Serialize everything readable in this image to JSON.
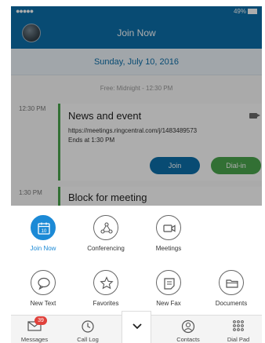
{
  "status_bar": {
    "signal": "●●●●●",
    "battery": "49%"
  },
  "header": {
    "title": "Join Now"
  },
  "calendar": {
    "date": "Sunday, July 10, 2016",
    "free_slot": "Free: Midnight - 12:30 PM",
    "events": [
      {
        "time": "12:30 PM",
        "title": "News and event",
        "link": "https://meetings.ringcentral.com/j/1483489573",
        "ends": "Ends at 1:30 PM",
        "join_label": "Join",
        "dial_label": "Dial-in"
      },
      {
        "time": "1:30 PM",
        "title": "Block for meeting"
      }
    ]
  },
  "actions": {
    "join_now": {
      "label": "Join Now",
      "icon": "calendar-icon",
      "date_num": "10"
    },
    "conferencing": {
      "label": "Conferencing",
      "icon": "conferencing-icon"
    },
    "meetings": {
      "label": "Meetings",
      "icon": "video-camera-icon"
    },
    "new_text": {
      "label": "New Text",
      "icon": "chat-bubble-icon"
    },
    "favorites": {
      "label": "Favorites",
      "icon": "star-icon"
    },
    "new_fax": {
      "label": "New Fax",
      "icon": "fax-icon"
    },
    "documents": {
      "label": "Documents",
      "icon": "folder-icon"
    }
  },
  "tabs": {
    "messages": {
      "label": "Messages",
      "badge": "39"
    },
    "call_log": {
      "label": "Call Log"
    },
    "contacts": {
      "label": "Contacts"
    },
    "dial_pad": {
      "label": "Dial Pad"
    }
  },
  "colors": {
    "brand_blue": "#0c6faa",
    "accent_blue": "#1c8ad6",
    "green": "#4aa54d",
    "badge_red": "#e0413b"
  }
}
